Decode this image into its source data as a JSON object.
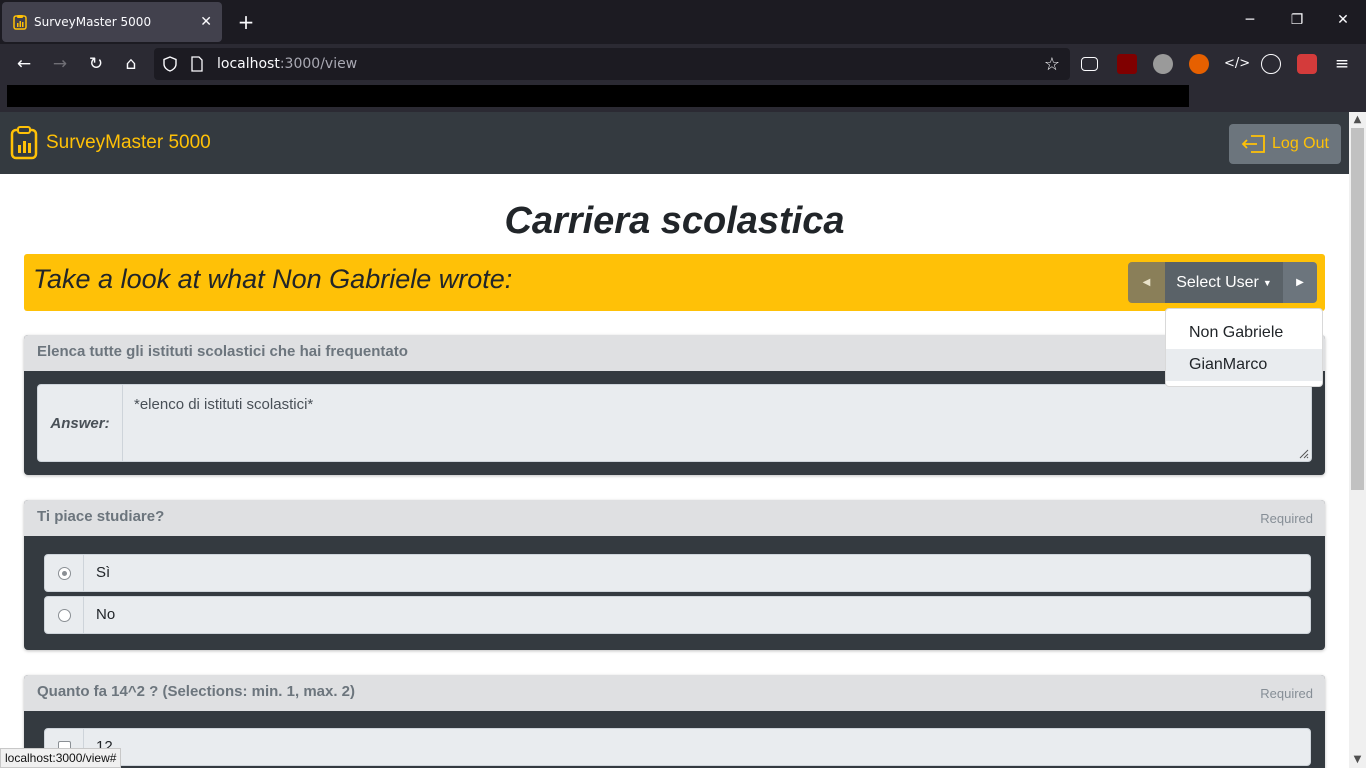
{
  "browser": {
    "tab_title": "SurveyMaster 5000",
    "tab_close": "✕",
    "new_tab": "+",
    "url_host": "localhost",
    "url_rest": ":3000/view",
    "status_url": "localhost:3000/view#"
  },
  "app": {
    "brand": "SurveyMaster 5000",
    "logout_label": "Log Out",
    "accent_color": "#ffc107"
  },
  "survey": {
    "title": "Carriera scolastica",
    "banner_text": "Take a look at what Non Gabriele wrote:",
    "select_user_label": "Select User",
    "users": [
      "Non Gabriele",
      "GianMarco"
    ]
  },
  "questions": [
    {
      "question": "Elenca tutte gli istituti scolastici che hai frequentato",
      "answer_label": "Answer:",
      "answer": "*elenco di istituti scolastici*"
    },
    {
      "question": "Ti piace studiare?",
      "required": "Required",
      "options": [
        "Sì",
        "No"
      ],
      "selected": "Sì"
    },
    {
      "question": "Quanto fa 14^2 ? (Selections: min. 1, max. 2)",
      "required": "Required",
      "options": [
        "12"
      ]
    }
  ]
}
